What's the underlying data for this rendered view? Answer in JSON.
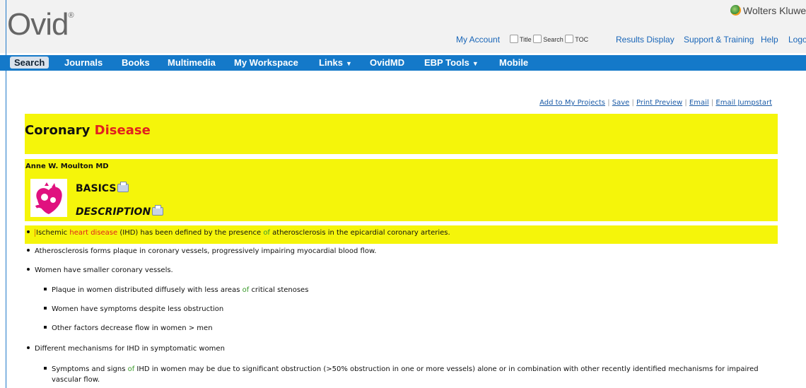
{
  "header": {
    "logo_text": "Ovid",
    "logo_mark": "®",
    "brand_text": "Wolters Kluwe",
    "my_account": "My Account",
    "checkbox_title": "Title",
    "checkbox_search": "Search",
    "checkbox_toc": "TOC",
    "results_display": "Results Display",
    "support_training": "Support & Training",
    "help": "Help",
    "logoff": "Logo"
  },
  "nav": {
    "search": "Search",
    "journals": "Journals",
    "books": "Books",
    "multimedia": "Multimedia",
    "my_workspace": "My Workspace",
    "links": "Links",
    "ovidmd": "OvidMD",
    "ebp_tools": "EBP Tools",
    "mobile": "Mobile"
  },
  "actions": {
    "add_projects": "Add to My Projects",
    "save": "Save",
    "print_preview": "Print Preview",
    "email": "Email",
    "email_jumpstart": "Email Jumpstart",
    "separator": "|"
  },
  "article": {
    "title_part1": "Coronary",
    "title_part2": "Disease",
    "author": "Anne W. Moulton MD",
    "section_basics": "BASICS",
    "section_description": "DESCRIPTION"
  },
  "bullets": {
    "b1_a": "Ischemic",
    "b1_b": "heart disease",
    "b1_c": "(IHD) has been defined by the presence",
    "b1_d": "of",
    "b1_e": "atherosclerosis in the epicardial coronary arteries.",
    "b2": "Atherosclerosis forms plaque in coronary vessels, progressively impairing myocardial blood flow.",
    "b3": "Women have smaller coronary vessels.",
    "b3_1_a": "Plaque in women distributed diffusely with less areas",
    "b3_1_b": "of",
    "b3_1_c": "critical stenoses",
    "b3_2": "Women have symptoms despite less obstruction",
    "b3_3": "Other factors decrease flow in women > men",
    "b4": "Different mechanisms for IHD in symptomatic women",
    "b4_1_a": "Symptoms and signs",
    "b4_1_b": "of",
    "b4_1_c": "IHD in women may be due to significant obstruction (>50% obstruction in one or more vessels) alone or in combination with other recently identified mechanisms for impaired vascular flow."
  }
}
